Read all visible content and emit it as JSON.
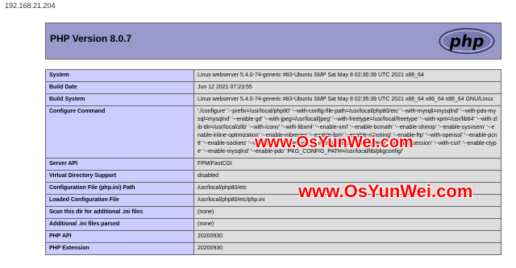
{
  "address": {
    "url": "192.168.21.204"
  },
  "header": {
    "title": "PHP Version 8.0.7",
    "logo_text": "php"
  },
  "rows": [
    {
      "key": "System",
      "value": "Linux webserver 5.4.0-74-generic #83-Ubuntu SMP Sat May 8 02:35:39 UTC 2021 x86_64"
    },
    {
      "key": "Build Date",
      "value": "Jun 12 2021 07:23:55"
    },
    {
      "key": "Build System",
      "value": "Linux webserver 5.4.0-74-generic #83-Ubuntu SMP Sat May 8 02:35:39 UTC 2021 x86_64 x86_64 x86_64 GNU/Linux"
    },
    {
      "key": "Configure Command",
      "value": "'./configure' '--prefix=/usr/local/php80' '--with-config-file-path=/usr/local/php80/etc' '--with-mysqli=mysqlnd' '--with-pdo-mysql=mysqlnd' '--enable-gd' '--with-jpeg=/usr/local/jpeg' '--with-freetype=/usr/local/freetype' '--with-xpm=/usr/lib64' '--with-zlib-dir=/usr/local/zlib' '--with-iconv' '--with-libxml' '--enable-xml' '--enable-bcmath' '--enable-shmop' '--enable-sysvsem' '--enable-inline-optimization' '--enable-mbregex' '--enable-fpm' '--enable-mbstring' '--enable-ftp' '--with-openssl' '--enable-pcntl' '--enable-sockets' '--with-zip' '--enable-soap' '--without-pear' '--with-gettext' '--enable-session' '--with-curl' '--enable-ctype' '--enable-mysqlnd' '--enable-pdo' 'PKG_CONFIG_PATH=/usr/local/lib/pkgconfig/'"
    },
    {
      "key": "Server API",
      "value": "FPM/FastCGI"
    },
    {
      "key": "Virtual Directory Support",
      "value": "disabled"
    },
    {
      "key": "Configuration File (php.ini) Path",
      "value": "/usr/local/php80/etc"
    },
    {
      "key": "Loaded Configuration File",
      "value": "/usr/local/php80/etc/php.ini"
    },
    {
      "key": "Scan this dir for additional .ini files",
      "value": "(none)"
    },
    {
      "key": "Additional .ini files parsed",
      "value": "(none)"
    },
    {
      "key": "PHP API",
      "value": "20200930"
    },
    {
      "key": "PHP Extension",
      "value": "20200930"
    }
  ],
  "watermark": {
    "text1": "www.OsYunWei.com",
    "text2": "www.OsYunWei.com"
  },
  "colors": {
    "header_bg": "#9999cc",
    "key_bg": "#ccccff",
    "value_bg": "#dddddd",
    "watermark": "#ff0000"
  }
}
